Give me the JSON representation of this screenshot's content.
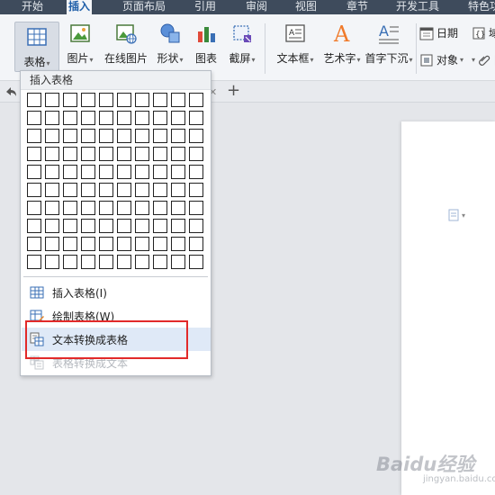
{
  "menu": {
    "tabs": [
      {
        "label": "开始"
      },
      {
        "label": "插入",
        "active": true
      },
      {
        "label": "页面布局"
      },
      {
        "label": "引用"
      },
      {
        "label": "审阅"
      },
      {
        "label": "视图"
      },
      {
        "label": "章节"
      },
      {
        "label": "开发工具"
      },
      {
        "label": "特色功"
      }
    ]
  },
  "ribbon": {
    "table_label": "表格",
    "picture_label": "图片",
    "online_picture_label": "在线图片",
    "shape_label": "形状",
    "chart_label": "图表",
    "screenshot_label": "截屏",
    "textbox_label": "文本框",
    "wordart_label": "艺术字",
    "dropcap_label": "首字下沉",
    "date_label": "日期",
    "object_label": "对象",
    "partial_a": "域",
    "partial_b": "附"
  },
  "dropdown": {
    "header": "插入表格",
    "grid_rows": 10,
    "grid_cols": 10,
    "items": [
      {
        "label": "插入表格(I)"
      },
      {
        "label": "绘制表格(W)"
      },
      {
        "label": "文本转换成表格",
        "hover": true
      },
      {
        "label": "表格转换成文本",
        "disabled": true
      }
    ]
  },
  "watermark": {
    "main": "Baidu经验",
    "sub": "jingyan.baidu.com"
  },
  "colors": {
    "menubar": "#3e4b5c",
    "ribbon": "#f3f5f8",
    "highlight": "#e22a2a",
    "hover": "#dfe9f7"
  }
}
